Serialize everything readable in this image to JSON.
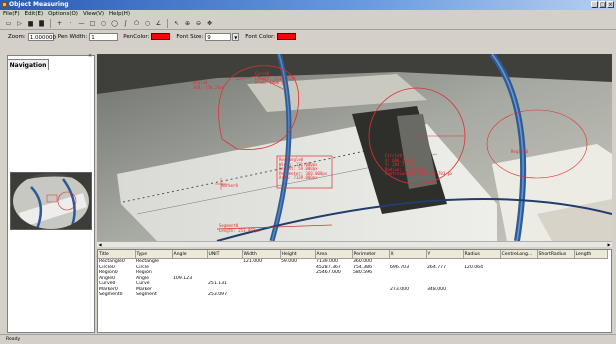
{
  "window": {
    "title": "Object Measuring",
    "controls": [
      "_",
      "□",
      "×"
    ]
  },
  "menu": [
    "File(F)",
    "Edit(E)",
    "Options(O)",
    "View(V)",
    "Help(H)"
  ],
  "toolbar2": {
    "zoom_label": "Zoom:",
    "zoom_value": "1.000000",
    "pen_width_label": "Pen Width:",
    "pen_width_value": "1",
    "pen_color_label": "PenColor:",
    "font_size_label": "Font Size:",
    "font_size_value": "9",
    "font_color_label": "Font Color:",
    "pen_color": "#ff0000",
    "font_color": "#ff0000"
  },
  "navigation": {
    "tab_label": "Navigation",
    "close": "×"
  },
  "annotations": [
    {
      "name": "angle-label",
      "text": "Angle0\n360, 150.23pt"
    },
    {
      "name": "curve-label",
      "text": "Curve0\nLength: 251.131pt\nArea: 1000 pt"
    },
    {
      "name": "circle-label",
      "text": "Circle0\nX: 696.703px\nY: 264.777px\nRadius: 120.064px\nCentreLongRadius: 696.703 px"
    },
    {
      "name": "rectangle-label",
      "text": "Rectangle0\nWidth: 121.000px\nHeight: 59.000px\nPerimeter: 360.000px\nArea: 7139.000px"
    },
    {
      "name": "marker-label",
      "text": "Marker0"
    },
    {
      "name": "segment-label",
      "text": "Segment0\nLength: 253.097px"
    },
    {
      "name": "region-label",
      "text": "Region0"
    }
  ],
  "table": {
    "columns": [
      "Title",
      "Type",
      "Angle",
      "UNIT",
      "Width",
      "Height",
      "Area",
      "Perimeter",
      "X",
      "Y",
      "Radius",
      "CentreLong...",
      "ShortRadius",
      "Length"
    ],
    "rows": [
      [
        "Rectangle0",
        "Rectangle",
        "",
        "",
        "121.000",
        "59.000",
        "7139.000",
        "360.000",
        "",
        "",
        "",
        "",
        "",
        ""
      ],
      [
        "Circle0",
        "Circle",
        "",
        "",
        "",
        "",
        "45287.367",
        "754.386",
        "696.703",
        "264.777",
        "120.064",
        "",
        "",
        ""
      ],
      [
        "Region0",
        "Region",
        "",
        "",
        "",
        "",
        "25467.000",
        "580.596",
        "",
        "",
        "",
        "",
        "",
        ""
      ],
      [
        "Angle0",
        "Angle",
        "109.123",
        "",
        "",
        "",
        "",
        "",
        "",
        "",
        "",
        "",
        "",
        ""
      ],
      [
        "Curve0",
        "Curve",
        "",
        "251.131",
        "",
        "",
        "",
        "",
        "",
        "",
        "",
        "",
        "",
        ""
      ],
      [
        "Marker0",
        "Marker",
        "",
        "",
        "",
        "",
        "",
        "",
        "273.000",
        "348.000",
        "",
        "",
        "",
        ""
      ],
      [
        "Segment0",
        "Segment",
        "",
        "253.097",
        "",
        "",
        "",
        "",
        "",
        "",
        "",
        "",
        "",
        ""
      ]
    ]
  },
  "status": {
    "text": "Ready"
  }
}
